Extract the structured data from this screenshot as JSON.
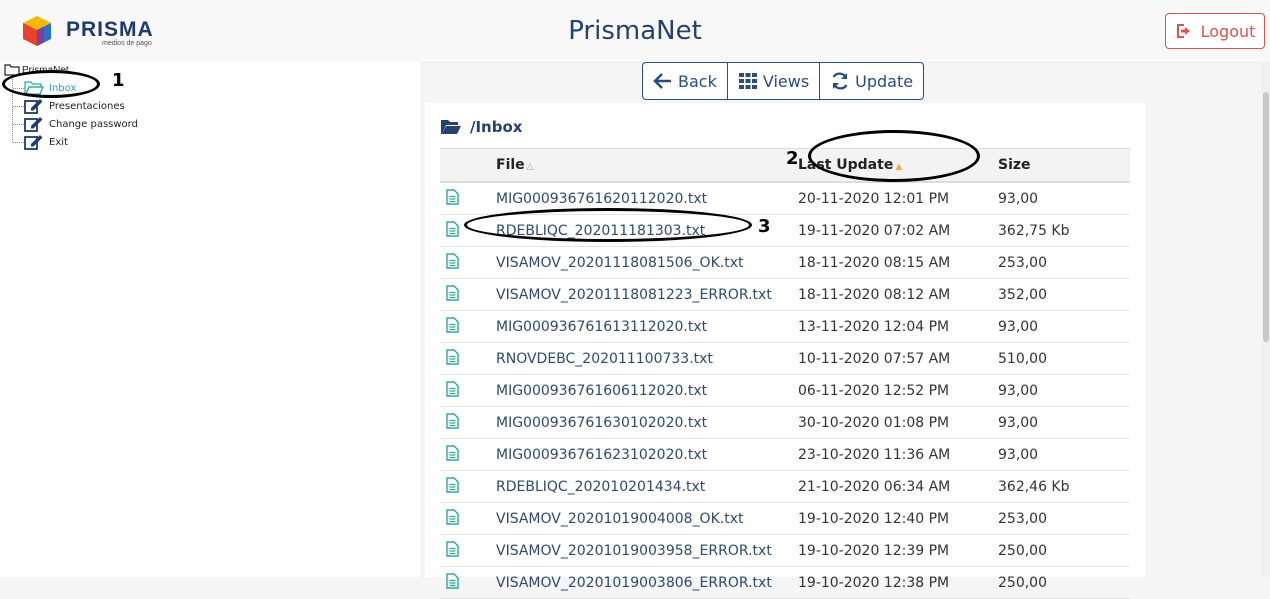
{
  "header": {
    "logo_word": "PRISMA",
    "logo_sub": "medios de pago",
    "title": "PrismaNet",
    "logout_label": "Logout"
  },
  "tree": {
    "root": "PrismaNet",
    "items": [
      {
        "label": "Inbox",
        "icon": "folder-open-icon",
        "active": true
      },
      {
        "label": "Presentaciones",
        "icon": "edit-icon",
        "active": false
      },
      {
        "label": "Change password",
        "icon": "edit-icon",
        "active": false
      },
      {
        "label": "Exit",
        "icon": "edit-icon",
        "active": false
      }
    ]
  },
  "toolbar": {
    "back_label": "Back",
    "views_label": "Views",
    "update_label": "Update"
  },
  "content": {
    "path": "/Inbox",
    "columns": {
      "file": "File",
      "last_update": "Last Update",
      "size": "Size"
    },
    "rows": [
      {
        "name": "MIG000936761620112020.txt",
        "date": "20-11-2020 12:01 PM",
        "size": "93,00"
      },
      {
        "name": "RDEBLIQC_202011181303.txt",
        "date": "19-11-2020 07:02 AM",
        "size": "362,75 Kb"
      },
      {
        "name": "VISAMOV_20201118081506_OK.txt",
        "date": "18-11-2020 08:15 AM",
        "size": "253,00"
      },
      {
        "name": "VISAMOV_20201118081223_ERROR.txt",
        "date": "18-11-2020 08:12 AM",
        "size": "352,00"
      },
      {
        "name": "MIG000936761613112020.txt",
        "date": "13-11-2020 12:04 PM",
        "size": "93,00"
      },
      {
        "name": "RNOVDEBC_202011100733.txt",
        "date": "10-11-2020 07:57 AM",
        "size": "510,00"
      },
      {
        "name": "MIG000936761606112020.txt",
        "date": "06-11-2020 12:52 PM",
        "size": "93,00"
      },
      {
        "name": "MIG000936761630102020.txt",
        "date": "30-10-2020 01:08 PM",
        "size": "93,00"
      },
      {
        "name": "MIG000936761623102020.txt",
        "date": "23-10-2020 11:36 AM",
        "size": "93,00"
      },
      {
        "name": "RDEBLIQC_202010201434.txt",
        "date": "21-10-2020 06:34 AM",
        "size": "362,46 Kb"
      },
      {
        "name": "VISAMOV_20201019004008_OK.txt",
        "date": "19-10-2020 12:40 PM",
        "size": "253,00"
      },
      {
        "name": "VISAMOV_20201019003958_ERROR.txt",
        "date": "19-10-2020 12:39 PM",
        "size": "250,00"
      },
      {
        "name": "VISAMOV_20201019003806_ERROR.txt",
        "date": "19-10-2020 12:38 PM",
        "size": "250,00"
      }
    ]
  },
  "annotations": [
    "1",
    "2",
    "3"
  ],
  "colors": {
    "accent": "#2aa8a0",
    "brand": "#24426b",
    "logout": "#d9534f",
    "sort_active": "#f0ad4e"
  }
}
